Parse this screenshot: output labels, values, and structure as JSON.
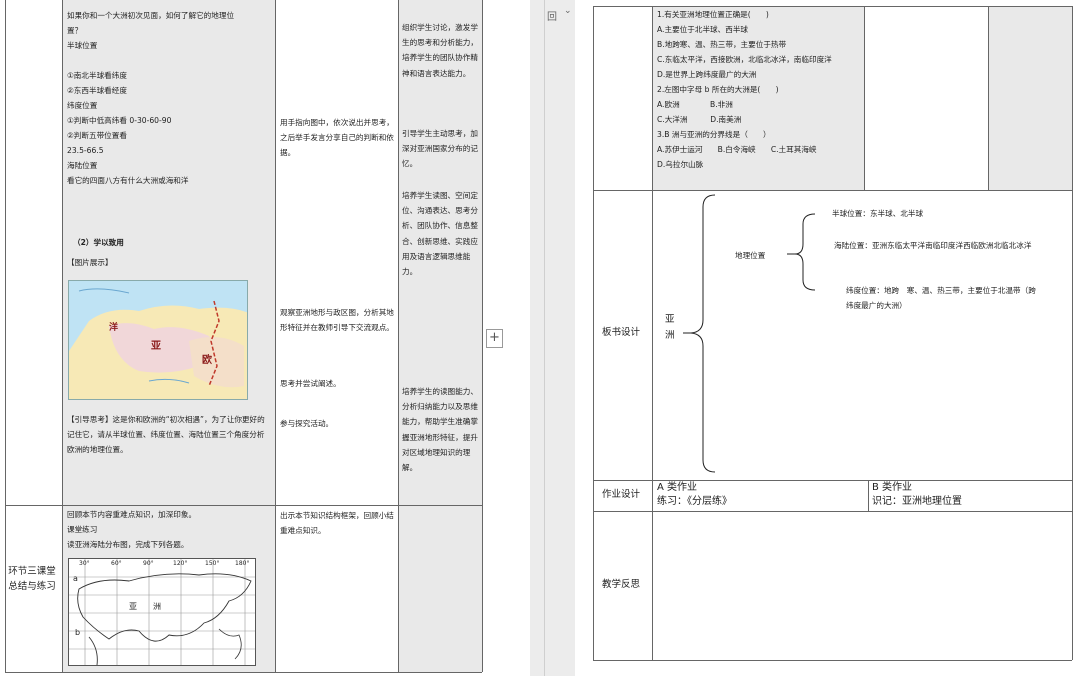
{
  "left_page": {
    "row1": {
      "content_lines": [
        "如果你和一个大洲初次见面，如何了解它的地理位",
        "置？",
        "半球位置",
        "",
        "①南北半球看纬度",
        "②东西半球看经度",
        "纬度位置",
        "①判断中低高纬看 0-30-60-90",
        "②判断五带位置看",
        "23.5-66.5",
        "海陆位置",
        "看它的四面八方有什么大洲或海和洋"
      ],
      "section_heading": "（2）学以致用",
      "picture_label": "【图片展示】",
      "guide_text": "【引导思考】这是你和欧洲的“初次相遇”，为了让你更好的记住它，请从半球位置、纬度位置、海陆位置三个角度分析欧洲的地理位置。",
      "map_labels": {
        "asia": "亚",
        "europe": "欧",
        "ocean": "洋"
      },
      "teacher_col": {
        "block1": "用手指向图中，依次说出并思考，之后举手发言分享自己的判断和依据。",
        "block2": "观察亚洲地形与政区图，分析其地形特征并在教师引导下交流观点。",
        "block3": "思考并尝试阐述。",
        "block4": "参与探究活动。"
      },
      "intent_col": {
        "block1": "组织学生讨论，激发学生的思考和分析能力，培养学生的团队协作精神和语言表达能力。",
        "block2": "引导学生主动思考，加深对亚洲国家分布的记忆。",
        "block3": "培养学生读图、空间定位、沟通表达、思考分析、团队协作、信息整合、创新思维、实践应用及语言逻辑思维能力。",
        "block4": "培养学生的读图能力、分析归纳能力以及思维能力，帮助学生准确掌握亚洲地形特征，提升对区域地理知识的理解。"
      }
    },
    "row2": {
      "stage_title": "环节三课堂总结与练习",
      "content_lines": [
        "回顾本节内容重难点知识，加深印象。",
        "课堂练习",
        "读亚洲海陆分布图，完成下列各题。"
      ],
      "teacher_text": "出示本节知识结构框架，回顾小结重难点知识。",
      "grid_map": {
        "longitudes": [
          "30°",
          "60°",
          "90°",
          "120°",
          "150°",
          "180°"
        ],
        "region_label": "亚　　洲",
        "letter_a": "a",
        "letter_b": "b"
      }
    }
  },
  "controls": {
    "view_toggle": "回",
    "view_toggle_arrow": "⌄",
    "add_button": "+"
  },
  "right_page": {
    "questions": [
      "1.有关亚洲地理位置正确是(　　)",
      "A.主要位于北半球、西半球",
      "B.地跨寒、温、热三带，主要位于热带",
      "C.东临太平洋，西接欧洲，北临北冰洋，南临印度洋",
      "D.是世界上跨纬度最广的大洲",
      "2.左图中字母 b 所在的大洲是(　　)",
      "A.欧洲　　　　B.非洲",
      "C.大洋洲　　　D.南美洲",
      "3.B 洲与亚洲的分界线是（　　）",
      "A.苏伊士运河　　B.白令海峡　　C.土耳其海峡",
      "D.乌拉尔山脉"
    ],
    "board": {
      "label": "板书设计",
      "main": "亚\n洲",
      "branch": "地理位置",
      "hemisphere": "半球位置：东半球、北半球",
      "sea_land": "海陆位置：亚洲东临太平洋南临印度洋西临欧洲北临北冰洋",
      "latitude": "纬度位置：地跨　寒、温、热三带，主要位于北温带（跨纬度最广的大洲）"
    },
    "homework": {
      "label": "作业设计",
      "a_title": "A 类作业",
      "a_text": "练习：《分层练》",
      "b_title": "B 类作业",
      "b_text": "识记：亚洲地理位置"
    },
    "reflection": {
      "label": "教学反思"
    }
  }
}
